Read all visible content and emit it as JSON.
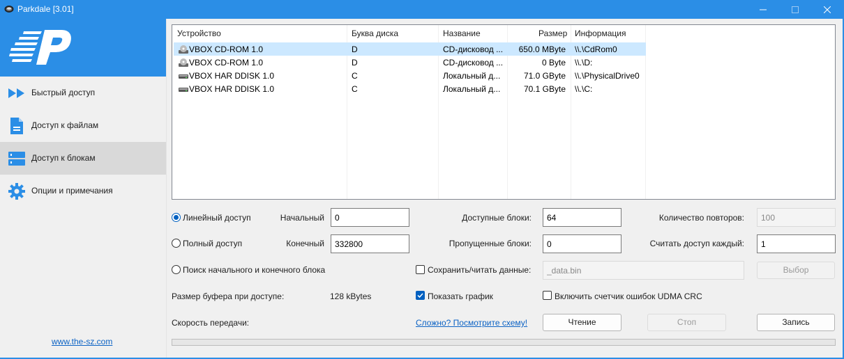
{
  "window": {
    "title": "Parkdale [3.01]",
    "accent": "#2b8ee6"
  },
  "sidebar": {
    "items": [
      {
        "label": "Быстрый доступ",
        "icon": "fast-forward-icon"
      },
      {
        "label": "Доступ к файлам",
        "icon": "file-icon"
      },
      {
        "label": "Доступ к блокам",
        "icon": "blocks-icon",
        "active": true
      },
      {
        "label": "Опции и примечания",
        "icon": "gear-icon"
      }
    ],
    "site_link": "www.the-sz.com"
  },
  "devices": {
    "columns": [
      "Устройство",
      "Буква диска",
      "Название",
      "Размер",
      "Информация"
    ],
    "rows": [
      {
        "device": "VBOX CD-ROM 1.0",
        "letter": "D",
        "name": "CD-дисковод ...",
        "size": "650.0 MByte",
        "info": "\\\\.\\CdRom0",
        "icon": "cdrom-icon",
        "selected": true
      },
      {
        "device": "VBOX CD-ROM 1.0",
        "letter": "D",
        "name": "CD-дисковод ...",
        "size": "0 Byte",
        "info": "\\\\.\\D:",
        "icon": "cdrom-icon"
      },
      {
        "device": "VBOX HAR DDISK 1.0",
        "letter": "C",
        "name": "Локальный д...",
        "size": "71.0 GByte",
        "info": "\\\\.\\PhysicalDrive0",
        "icon": "harddisk-icon"
      },
      {
        "device": "VBOX HAR DDISK 1.0",
        "letter": "C",
        "name": "Локальный д...",
        "size": "70.1 GByte",
        "info": "\\\\.\\C:",
        "icon": "harddisk-icon"
      }
    ]
  },
  "options": {
    "radio_linear": "Линейный доступ",
    "radio_full": "Полный доступ",
    "radio_search": "Поиск начального и конечного блока",
    "selected_mode": "linear",
    "start_label": "Начальный",
    "start_value": "0",
    "end_label": "Конечный",
    "end_value": "332800",
    "available_blocks_label": "Доступные блоки:",
    "available_blocks_value": "64",
    "skipped_blocks_label": "Пропущенные блоки:",
    "skipped_blocks_value": "0",
    "repeat_count_label": "Количество повторов:",
    "repeat_count_value": "100",
    "read_each_label": "Считать доступ каждый:",
    "read_each_value": "1",
    "save_read_label": "Сохранить/читать данные:",
    "save_read_checked": false,
    "file_value": "_data.bin",
    "browse_label": "Выбор",
    "buffer_label": "Размер буфера при доступе:",
    "buffer_value": "128 kBytes",
    "show_graph_label": "Показать график",
    "show_graph_checked": true,
    "udma_label": "Включить счетчик ошибок UDMA CRC",
    "udma_checked": false,
    "speed_label": "Скорость передачи:",
    "scheme_link": "Сложно? Посмотрите схему!",
    "read_button": "Чтение",
    "stop_button": "Стоп",
    "write_button": "Запись",
    "progress": 0
  }
}
